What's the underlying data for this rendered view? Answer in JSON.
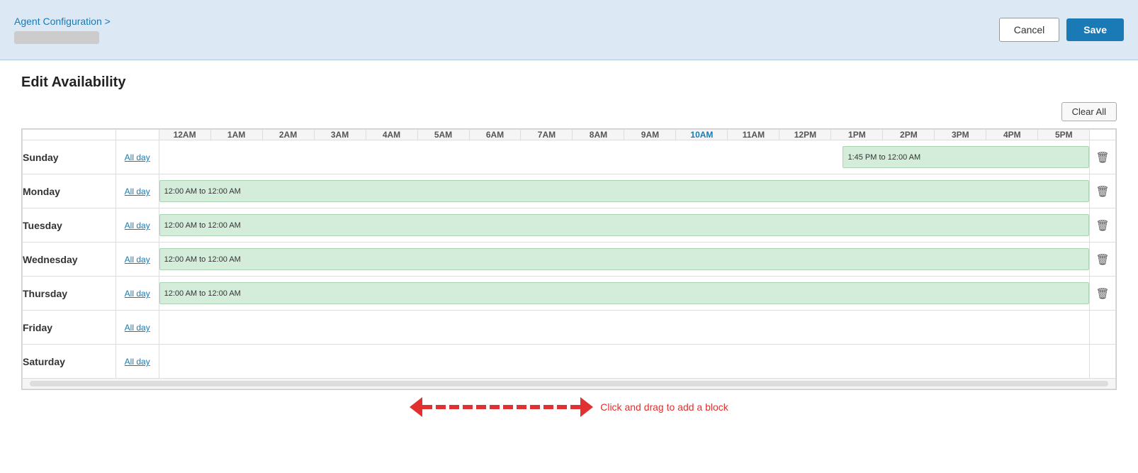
{
  "header": {
    "breadcrumb": "Agent Configuration >",
    "cancel_label": "Cancel",
    "save_label": "Save"
  },
  "page": {
    "title": "Edit Availability",
    "clear_all_label": "Clear All"
  },
  "hours": [
    {
      "label": "12AM",
      "highlighted": false
    },
    {
      "label": "1AM",
      "highlighted": false
    },
    {
      "label": "2AM",
      "highlighted": false
    },
    {
      "label": "3AM",
      "highlighted": false
    },
    {
      "label": "4AM",
      "highlighted": false
    },
    {
      "label": "5AM",
      "highlighted": false
    },
    {
      "label": "6AM",
      "highlighted": false
    },
    {
      "label": "7AM",
      "highlighted": false
    },
    {
      "label": "8AM",
      "highlighted": false
    },
    {
      "label": "9AM",
      "highlighted": false
    },
    {
      "label": "10AM",
      "highlighted": true
    },
    {
      "label": "11AM",
      "highlighted": false
    },
    {
      "label": "12PM",
      "highlighted": false
    },
    {
      "label": "1PM",
      "highlighted": false
    },
    {
      "label": "2PM",
      "highlighted": false
    },
    {
      "label": "3PM",
      "highlighted": false
    },
    {
      "label": "4PM",
      "highlighted": false
    },
    {
      "label": "5PM",
      "highlighted": false
    }
  ],
  "days": [
    {
      "name": "Sunday",
      "allday_label": "All day",
      "allday_link": true,
      "has_block": true,
      "block_type": "partial",
      "block_text": "1:45 PM to 12:00 AM",
      "block_start_percent": 73.5,
      "block_width_percent": 26.5,
      "has_delete": true
    },
    {
      "name": "Monday",
      "allday_label": "All day",
      "allday_link": true,
      "has_block": true,
      "block_type": "full",
      "block_text": "12:00 AM to 12:00 AM",
      "block_start_percent": 0,
      "block_width_percent": 100,
      "has_delete": true
    },
    {
      "name": "Tuesday",
      "allday_label": "All day",
      "allday_link": true,
      "has_block": true,
      "block_type": "full",
      "block_text": "12:00 AM to 12:00 AM",
      "block_start_percent": 0,
      "block_width_percent": 100,
      "has_delete": true
    },
    {
      "name": "Wednesday",
      "allday_label": "All day",
      "allday_link": true,
      "has_block": true,
      "block_type": "full",
      "block_text": "12:00 AM to 12:00 AM",
      "block_start_percent": 0,
      "block_width_percent": 100,
      "has_delete": true
    },
    {
      "name": "Thursday",
      "allday_label": "All day",
      "allday_link": true,
      "has_block": true,
      "block_type": "full",
      "block_text": "12:00 AM to 12:00 AM",
      "block_start_percent": 0,
      "block_width_percent": 100,
      "has_delete": true
    },
    {
      "name": "Friday",
      "allday_label": "All day",
      "allday_link": true,
      "has_block": false,
      "block_text": "",
      "has_delete": false
    },
    {
      "name": "Saturday",
      "allday_label": "All day",
      "allday_link": true,
      "has_block": false,
      "block_text": "",
      "has_delete": false
    }
  ],
  "drag_hint": {
    "text": "Click and drag to add a block"
  }
}
